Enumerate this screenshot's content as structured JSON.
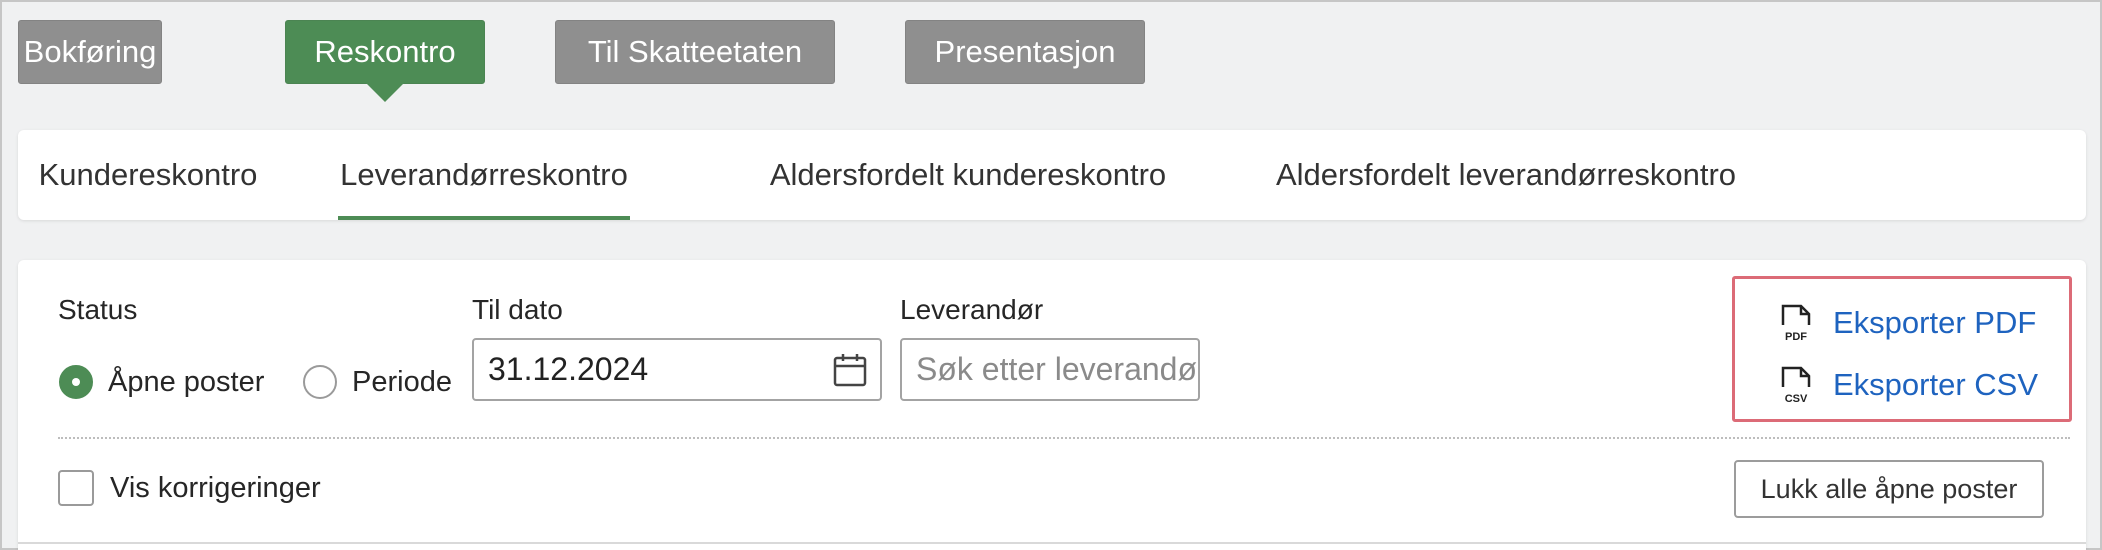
{
  "topnav": {
    "items": [
      {
        "label": "Bokføring",
        "active": false
      },
      {
        "label": "Reskontro",
        "active": true
      },
      {
        "label": "Til Skatteetaten",
        "active": false
      },
      {
        "label": "Presentasjon",
        "active": false
      }
    ]
  },
  "subtabs": {
    "items": [
      {
        "label": "Kundereskontro",
        "active": false
      },
      {
        "label": "Leverandørreskontro",
        "active": true
      },
      {
        "label": "Aldersfordelt kundereskontro",
        "active": false
      },
      {
        "label": "Aldersfordelt leverandørreskontro",
        "active": false
      }
    ]
  },
  "filter": {
    "status_label": "Status",
    "status_options": [
      {
        "label": "Åpne poster",
        "checked": true
      },
      {
        "label": "Periode",
        "checked": false
      }
    ],
    "date_label": "Til dato",
    "date_value": "31.12.2024",
    "supplier_label": "Leverandør",
    "supplier_placeholder": "Søk etter leverandør",
    "show_corrections_label": "Vis korrigeringer",
    "show_corrections_checked": false,
    "close_all_button": "Lukk alle åpne poster"
  },
  "export": {
    "pdf": {
      "icon_text": "PDF",
      "label": "Eksporter PDF"
    },
    "csv": {
      "icon_text": "CSV",
      "label": "Eksporter CSV"
    }
  },
  "colors": {
    "accent_green": "#4d8c55",
    "nav_gray": "#8f8f8f",
    "link_blue": "#1e63bf",
    "highlight_red": "#dc6b77"
  }
}
